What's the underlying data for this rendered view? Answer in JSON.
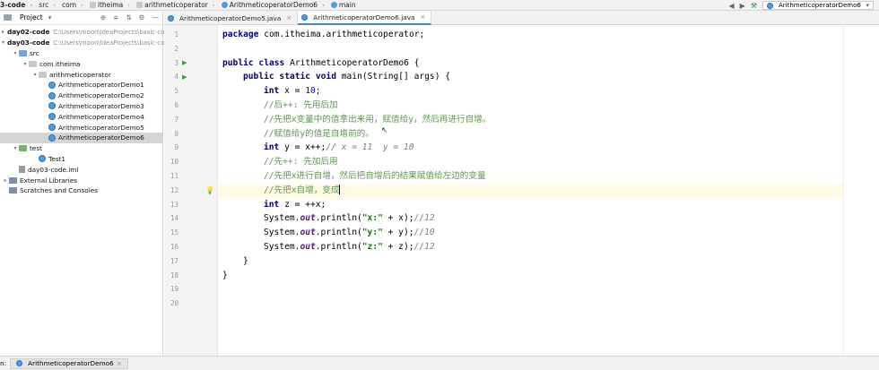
{
  "breadcrumb": [
    "3-code",
    "src",
    "com",
    "itheima",
    "arithmeticoperator",
    "ArithmeticoperatorDemo6",
    "main"
  ],
  "run_config": "ArithmeticoperatorDemo6",
  "project_panel": {
    "title": "Project",
    "tree": [
      {
        "label": "day02-code",
        "path": "C:\\Users\\moon\\IdeaProjects\\basic-co",
        "indent": 0,
        "icon": "folder",
        "bold": true,
        "arrow": ">"
      },
      {
        "label": "day03-code",
        "path": "C:\\Users\\moon\\IdeaProjects\\basic-co",
        "indent": 0,
        "icon": "folder",
        "bold": true,
        "arrow": "v"
      },
      {
        "label": "src",
        "indent": 1,
        "icon": "folder-blue",
        "arrow": "v"
      },
      {
        "label": "com.itheima",
        "indent": 2,
        "icon": "package",
        "arrow": "v"
      },
      {
        "label": "arithmeticoperator",
        "indent": 3,
        "icon": "package",
        "arrow": "v"
      },
      {
        "label": "ArithmeticoperatorDemo1",
        "indent": 4,
        "icon": "class"
      },
      {
        "label": "ArithmeticoperatorDemo2",
        "indent": 4,
        "icon": "class"
      },
      {
        "label": "ArithmeticoperatorDemo3",
        "indent": 4,
        "icon": "class"
      },
      {
        "label": "ArithmeticoperatorDemo4",
        "indent": 4,
        "icon": "class"
      },
      {
        "label": "ArithmeticoperatorDemo5",
        "indent": 4,
        "icon": "class"
      },
      {
        "label": "ArithmeticoperatorDemo6",
        "indent": 4,
        "icon": "class",
        "selected": true
      },
      {
        "label": "test",
        "indent": 1,
        "icon": "folder-green",
        "arrow": "v"
      },
      {
        "label": "Test1",
        "indent": 3,
        "icon": "class"
      },
      {
        "label": "day03-code.iml",
        "indent": 1,
        "icon": "iml"
      },
      {
        "label": "External Libraries",
        "indent": 0,
        "icon": "library",
        "arrow": ">"
      },
      {
        "label": "Scratches and Consoles",
        "indent": 0,
        "icon": "scratch",
        "arrow": ""
      }
    ]
  },
  "tabs": [
    {
      "label": "ArithmeticoperatorDemo5.java",
      "active": false
    },
    {
      "label": "ArithmeticoperatorDemo6.java",
      "active": true
    }
  ],
  "editor": {
    "current_line": 12,
    "lines": [
      {
        "n": 1,
        "indent": 0,
        "tokens": [
          [
            "kw",
            "package"
          ],
          [
            "",
            " com.itheima.arithmeticoperator;"
          ]
        ]
      },
      {
        "n": 2,
        "indent": 0,
        "tokens": []
      },
      {
        "n": 3,
        "indent": 0,
        "run": true,
        "tokens": [
          [
            "kw",
            "public class"
          ],
          [
            "",
            " ArithmeticoperatorDemo6 {"
          ]
        ]
      },
      {
        "n": 4,
        "indent": 1,
        "run": true,
        "tokens": [
          [
            "kw",
            "public static void"
          ],
          [
            "",
            " main(String[] args) {"
          ]
        ]
      },
      {
        "n": 5,
        "indent": 2,
        "tokens": [
          [
            "kw",
            "int"
          ],
          [
            "",
            " x = "
          ],
          [
            "num",
            "10"
          ],
          [
            "",
            ";"
          ]
        ]
      },
      {
        "n": 6,
        "indent": 2,
        "tokens": [
          [
            "cmg",
            "//后++: 先用后加"
          ]
        ]
      },
      {
        "n": 7,
        "indent": 2,
        "tokens": [
          [
            "cmg",
            "//先把x变量中的值拿出来用，赋值给y，然后再进行自增。"
          ]
        ]
      },
      {
        "n": 8,
        "indent": 2,
        "tokens": [
          [
            "cmg",
            "//赋值给y的值是自增前的。"
          ]
        ]
      },
      {
        "n": 9,
        "indent": 2,
        "tokens": [
          [
            "kw",
            "int"
          ],
          [
            "",
            " y = x++;"
          ],
          [
            "cm",
            "// x = 11  y = 10"
          ]
        ]
      },
      {
        "n": 10,
        "indent": 2,
        "tokens": [
          [
            "cmg",
            "//先++: 先加后用"
          ]
        ]
      },
      {
        "n": 11,
        "indent": 2,
        "tokens": [
          [
            "cmg",
            "//先把x进行自增，然后把自增后的结果赋值给左边的变量"
          ]
        ]
      },
      {
        "n": 12,
        "indent": 2,
        "bulb": true,
        "tokens": [
          [
            "cmg",
            "//先把x自增，变成"
          ]
        ]
      },
      {
        "n": 13,
        "indent": 2,
        "tokens": [
          [
            "kw",
            "int"
          ],
          [
            "",
            " z = ++x;"
          ]
        ]
      },
      {
        "n": 14,
        "indent": 2,
        "tokens": [
          [
            "",
            "System."
          ],
          [
            "fld",
            "out"
          ],
          [
            "",
            ".println("
          ],
          [
            "str",
            "\"x:\""
          ],
          [
            "",
            " + x);"
          ],
          [
            "cm",
            "//12"
          ]
        ]
      },
      {
        "n": 15,
        "indent": 2,
        "tokens": [
          [
            "",
            "System."
          ],
          [
            "fld",
            "out"
          ],
          [
            "",
            ".println("
          ],
          [
            "str",
            "\"y:\""
          ],
          [
            "",
            " + y);"
          ],
          [
            "cm",
            "//10"
          ]
        ]
      },
      {
        "n": 16,
        "indent": 2,
        "tokens": [
          [
            "",
            "System."
          ],
          [
            "fld",
            "out"
          ],
          [
            "",
            ".println("
          ],
          [
            "str",
            "\"z:\""
          ],
          [
            "",
            " + z);"
          ],
          [
            "cm",
            "//12"
          ]
        ]
      },
      {
        "n": 17,
        "indent": 1,
        "tokens": [
          [
            "",
            "}"
          ]
        ]
      },
      {
        "n": 18,
        "indent": 0,
        "tokens": [
          [
            "",
            "}"
          ]
        ]
      },
      {
        "n": 19,
        "indent": 0,
        "tokens": []
      },
      {
        "n": 20,
        "indent": 0,
        "tokens": []
      }
    ]
  },
  "status": {
    "prefix": "n:",
    "run_tab": "ArithmeticoperatorDemo6"
  }
}
